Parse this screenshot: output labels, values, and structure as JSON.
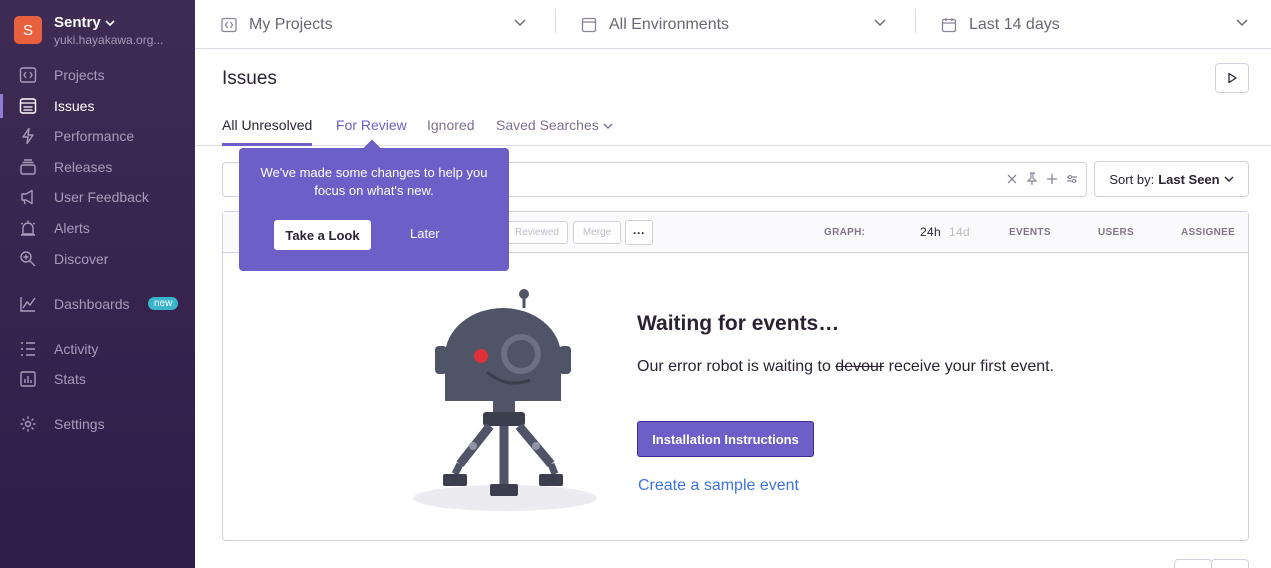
{
  "org": {
    "initial": "S",
    "name": "Sentry",
    "user": "yuki.hayakawa.org..."
  },
  "nav": {
    "projects": "Projects",
    "issues": "Issues",
    "performance": "Performance",
    "releases": "Releases",
    "user_feedback": "User Feedback",
    "alerts": "Alerts",
    "discover": "Discover",
    "dashboards": "Dashboards",
    "dashboards_badge": "new",
    "activity": "Activity",
    "stats": "Stats",
    "settings": "Settings"
  },
  "header": {
    "projects": "My Projects",
    "environments": "All Environments",
    "period": "Last 14 days"
  },
  "page": {
    "title": "Issues"
  },
  "tabs": {
    "all_unresolved": "All Unresolved",
    "for_review": "For Review",
    "ignored": "Ignored",
    "saved_searches": "Saved Searches"
  },
  "sort": {
    "label": "Sort by:",
    "value": "Last Seen"
  },
  "table": {
    "reviewed": "Reviewed",
    "merge": "Merge",
    "more": "···",
    "graph": "GRAPH:",
    "period_24h": "24h",
    "period_14d": "14d",
    "events": "EVENTS",
    "users": "USERS",
    "assignee": "ASSIGNEE"
  },
  "empty": {
    "title": "Waiting for events…",
    "desc_before": "Our error robot is waiting to ",
    "desc_strike": "devour",
    "desc_after": " receive your first event.",
    "install_button": "Installation Instructions",
    "sample_link": "Create a sample event"
  },
  "popover": {
    "text": "We've made some changes to help you focus on what's new.",
    "primary": "Take a Look",
    "secondary": "Later"
  },
  "colors": {
    "sidebar": "#3e2c54",
    "accent": "#6c5fc7",
    "link": "#3d74db",
    "org_avatar": "#e8613f"
  }
}
